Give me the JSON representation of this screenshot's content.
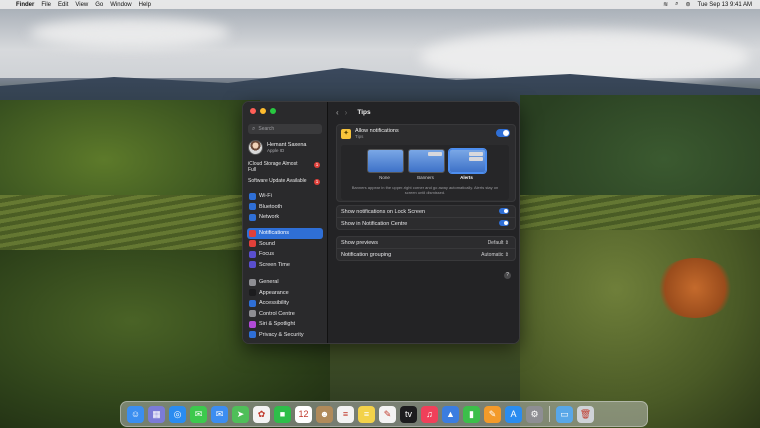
{
  "menubar": {
    "items": [
      "Finder",
      "File",
      "Edit",
      "View",
      "Go",
      "Window",
      "Help"
    ],
    "datetime": "Tue Sep 13  9:41 AM"
  },
  "sidebar": {
    "search_placeholder": "Search",
    "account": {
      "name": "Hemant Saxena",
      "sub": "Apple ID"
    },
    "alerts": [
      {
        "label": "iCloud Storage Almost Full",
        "badge": "1"
      },
      {
        "label": "Software Update Available",
        "badge": "1"
      }
    ],
    "group1": [
      {
        "label": "Wi-Fi",
        "icon": "wifi-icon",
        "color": "#2f6fd6"
      },
      {
        "label": "Bluetooth",
        "icon": "bluetooth-icon",
        "color": "#2f6fd6"
      },
      {
        "label": "Network",
        "icon": "network-icon",
        "color": "#2f6fd6"
      }
    ],
    "group2": [
      {
        "label": "Notifications",
        "icon": "bell-icon",
        "color": "#e0403a",
        "active": true
      },
      {
        "label": "Sound",
        "icon": "speaker-icon",
        "color": "#e0403a"
      },
      {
        "label": "Focus",
        "icon": "moon-icon",
        "color": "#5a4fcf"
      },
      {
        "label": "Screen Time",
        "icon": "hourglass-icon",
        "color": "#5a4fcf"
      }
    ],
    "group3": [
      {
        "label": "General",
        "icon": "gear-icon",
        "color": "#8e8e93"
      },
      {
        "label": "Appearance",
        "icon": "appearance-icon",
        "color": "#1c1c1e"
      },
      {
        "label": "Accessibility",
        "icon": "accessibility-icon",
        "color": "#2f6fd6"
      },
      {
        "label": "Control Centre",
        "icon": "control-centre-icon",
        "color": "#8e8e93"
      },
      {
        "label": "Siri & Spotlight",
        "icon": "siri-icon",
        "color": "#b24bd8"
      },
      {
        "label": "Privacy & Security",
        "icon": "hand-icon",
        "color": "#2f6fd6"
      }
    ]
  },
  "content": {
    "title": "Tips",
    "allow": {
      "label": "Allow notifications",
      "sub": "Tips",
      "enabled": true
    },
    "styles": [
      {
        "name": "None",
        "selected": false
      },
      {
        "name": "Banners",
        "selected": false
      },
      {
        "name": "Alerts",
        "selected": true
      }
    ],
    "style_desc": "Banners appear in the upper-right corner and go away automatically. Alerts stay on screen until dismissed.",
    "toggles": [
      {
        "label": "Show notifications on Lock Screen",
        "enabled": true
      },
      {
        "label": "Show in Notification Centre",
        "enabled": true
      }
    ],
    "selects": [
      {
        "label": "Show previews",
        "value": "Default"
      },
      {
        "label": "Notification grouping",
        "value": "Automatic"
      }
    ],
    "help": "?"
  },
  "dock": [
    {
      "icon": "finder-icon",
      "color": "#3b8ef0",
      "glyph": "☺"
    },
    {
      "icon": "launchpad-icon",
      "color": "#7b7bd6",
      "glyph": "▦"
    },
    {
      "icon": "safari-icon",
      "color": "#2a8cf0",
      "glyph": "◎"
    },
    {
      "icon": "messages-icon",
      "color": "#3cc94d",
      "glyph": "✉"
    },
    {
      "icon": "mail-icon",
      "color": "#3c8df0",
      "glyph": "✉"
    },
    {
      "icon": "maps-icon",
      "color": "#4fbf59",
      "glyph": "➤"
    },
    {
      "icon": "photos-icon",
      "color": "#f3f3f3",
      "glyph": "✿"
    },
    {
      "icon": "facetime-icon",
      "color": "#2ebe4a",
      "glyph": "■"
    },
    {
      "icon": "calendar-icon",
      "color": "#ffffff",
      "glyph": "12"
    },
    {
      "icon": "contacts-icon",
      "color": "#b08a5a",
      "glyph": "☻"
    },
    {
      "icon": "reminders-icon",
      "color": "#f3f3f3",
      "glyph": "≡"
    },
    {
      "icon": "notes-icon",
      "color": "#f3d24a",
      "glyph": "≡"
    },
    {
      "icon": "freeform-icon",
      "color": "#f3f3f3",
      "glyph": "✎"
    },
    {
      "icon": "tv-icon",
      "color": "#1c1c1e",
      "glyph": "tv"
    },
    {
      "icon": "music-icon",
      "color": "#f0405a",
      "glyph": "♫"
    },
    {
      "icon": "keynote-icon",
      "color": "#3b7de0",
      "glyph": "▲"
    },
    {
      "icon": "numbers-icon",
      "color": "#3cbf4a",
      "glyph": "▮"
    },
    {
      "icon": "pages-icon",
      "color": "#f39a2a",
      "glyph": "✎"
    },
    {
      "icon": "app-store-icon",
      "color": "#2a8cf0",
      "glyph": "A"
    },
    {
      "icon": "system-settings-icon",
      "color": "#8e8e93",
      "glyph": "⚙"
    }
  ],
  "dock_right": [
    {
      "icon": "downloads-folder-icon",
      "color": "#58a7e8",
      "glyph": "▭"
    },
    {
      "icon": "trash-icon",
      "color": "#cfd3d8",
      "glyph": "🗑"
    }
  ]
}
